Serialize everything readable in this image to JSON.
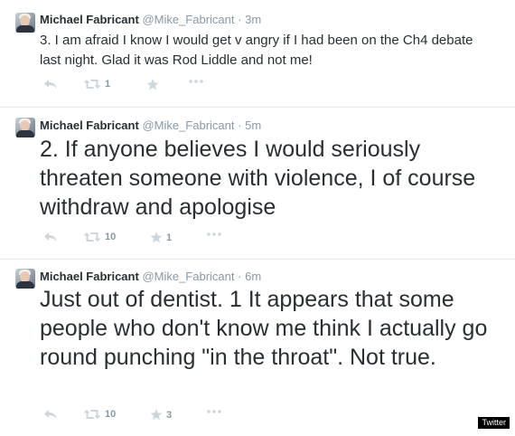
{
  "tweets": [
    {
      "name": "Michael Fabricant",
      "handle": "@Mike_Fabricant",
      "separator": "·",
      "time": "3m",
      "text": "3. I am afraid I know I would get v angry if I had been on the Ch4 debate last night. Glad it was Rod Liddle and not me!",
      "retweets": "1",
      "favorites": ""
    },
    {
      "name": "Michael Fabricant",
      "handle": "@Mike_Fabricant",
      "separator": "·",
      "time": "5m",
      "text": "2. If anyone believes I would seriously threaten someone with violence, I of course withdraw and apologise",
      "retweets": "10",
      "favorites": "1"
    },
    {
      "name": "Michael Fabricant",
      "handle": "@Mike_Fabricant",
      "separator": "·",
      "time": "6m",
      "text": "Just out of dentist. 1 It appears that some people who don't know me think I actually go round punching \"in the throat\". Not true.",
      "retweets": "10",
      "favorites": "3"
    }
  ],
  "icons": {
    "reply": "reply-icon",
    "retweet": "retweet-icon",
    "favorite": "star-icon",
    "more": "more-icon"
  },
  "colors": {
    "text": "#292f33",
    "muted": "#8899a6",
    "icon": "#ccd6dd",
    "divider": "#e1e8ed"
  },
  "watermark": "Twitter"
}
